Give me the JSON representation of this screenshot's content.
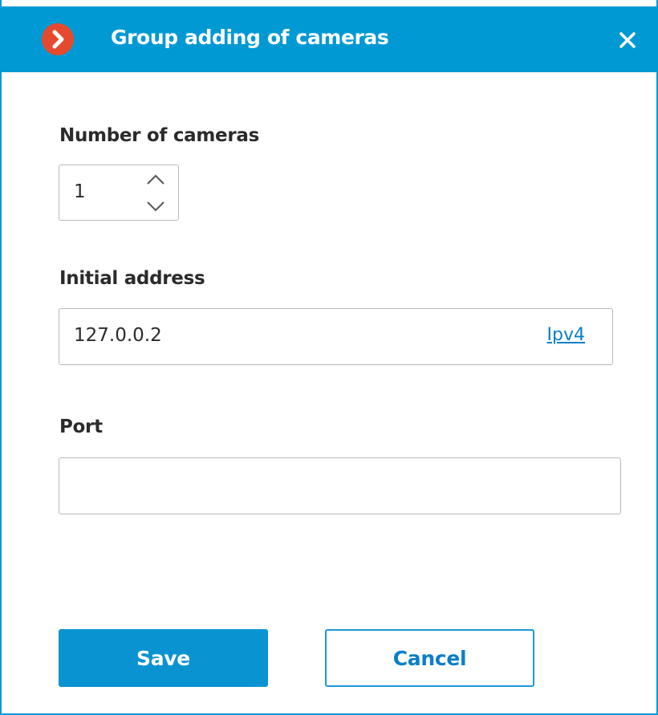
{
  "window": {
    "title": "Group adding of cameras",
    "logo_icon": "chevron-right-icon",
    "close_icon": "close-icon",
    "accent_color": "#0099d4",
    "logo_color": "#e64a2e"
  },
  "fields": {
    "number_of_cameras": {
      "label": "Number of cameras",
      "value": "1",
      "up_icon": "chevron-up-icon",
      "down_icon": "chevron-down-icon"
    },
    "initial_address": {
      "label": "Initial address",
      "value": "127.0.0.2",
      "protocol_link": "Ipv4"
    },
    "port": {
      "label": "Port",
      "value": ""
    }
  },
  "buttons": {
    "save_label": "Save",
    "cancel_label": "Cancel"
  }
}
